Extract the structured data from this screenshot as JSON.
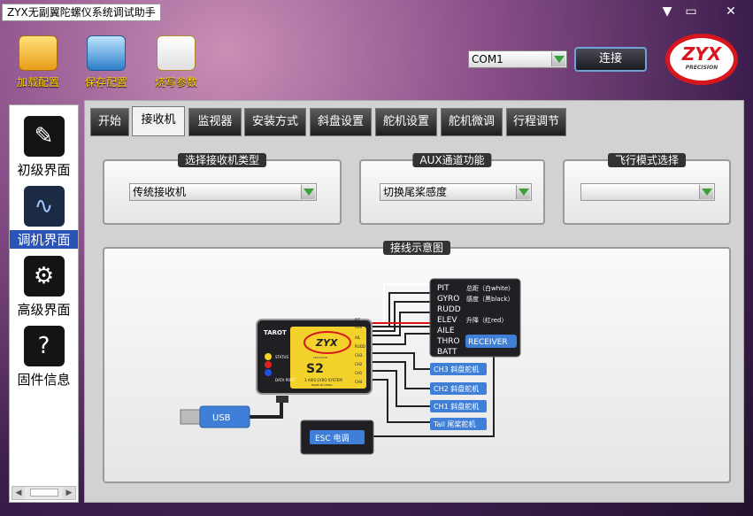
{
  "window": {
    "title": "ZYX无副翼陀螺仪系统调试助手",
    "minimize_glyph": "▼",
    "close_glyph": "✕"
  },
  "toolbar": {
    "load_label": "加载配置",
    "save_label": "保存配置",
    "flash_label": "烧写参数",
    "com_port": "COM1",
    "connect_label": "连接",
    "logo_text": "ZYX",
    "logo_sub": "PRECISION"
  },
  "sidebar": {
    "items": [
      {
        "label": "初级界面",
        "icon": "wrench-icon"
      },
      {
        "label": "调机界面",
        "icon": "pulse-icon"
      },
      {
        "label": "高级界面",
        "icon": "gear-icon"
      },
      {
        "label": "固件信息",
        "icon": "firmware-icon"
      }
    ]
  },
  "tabs": [
    "开始",
    "接收机",
    "监视器",
    "安装方式",
    "斜盘设置",
    "舵机设置",
    "舵机微调",
    "行程调节"
  ],
  "receiver": {
    "type_title": "选择接收机类型",
    "type_value": "传统接收机",
    "aux_title": "AUX通道功能",
    "aux_value": "切换尾桨感度",
    "flight_mode_title": "飞行模式选择",
    "flight_mode_value": ""
  },
  "diagram": {
    "title": "接线示意图",
    "device_brand": "TAROT",
    "device_logo": "ZYX",
    "device_logo_sub": "PRECISION",
    "device_model": "S2",
    "device_subtitle": "3 AXIS GYRO SYSTEM",
    "device_made": "MADE IN CHINA",
    "status_label": "STATUS",
    "data_port_label": "DATA PORT",
    "top_pins": [
      "PIT",
      "ELEV",
      "AUX"
    ],
    "pins": [
      "AIL",
      "RUDD",
      "CH3",
      "CH2",
      "CH1",
      "CH4"
    ],
    "receiver_channels": [
      "PIT",
      "GYRO",
      "RUDD",
      "ELEV",
      "AILE",
      "THRO",
      "BATT"
    ],
    "receiver_notes": [
      "总距（白white）",
      "感度（黑black）",
      "",
      "升降（红red）",
      "",
      "",
      ""
    ],
    "receiver_label": "RECEIVER",
    "outputs": [
      "CH3 斜盘舵机",
      "CH2 斜盘舵机",
      "CH1 斜盘舵机",
      "Tail 尾桨舵机"
    ],
    "usb_label": "USB",
    "esc_label": "ESC 电调"
  },
  "colors": {
    "accent_yellow": "#ffd200",
    "brand_red": "#d8161d",
    "button_blue": "#3f7fd8"
  }
}
